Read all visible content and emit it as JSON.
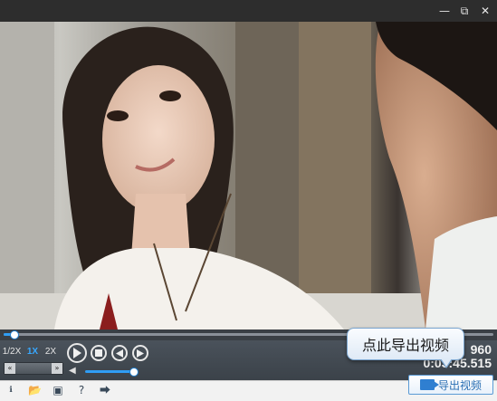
{
  "window": {
    "minimize_icon": "minimize-icon",
    "restore_icon": "restore-icon",
    "close_icon": "close-icon"
  },
  "player": {
    "progress_fraction": 0.02,
    "volume_fraction": 0.95,
    "speeds": [
      "1/2X",
      "1X",
      "2X"
    ],
    "active_speed": "1X",
    "time_top": "960",
    "time_bottom": "0:03:45.515"
  },
  "tooltip": {
    "text": "点此导出视频"
  },
  "export": {
    "label": "导出视频",
    "accent": "#2f7fd1"
  },
  "toolbar": {
    "icons": [
      "video-info-icon",
      "open-folder-icon",
      "save-icon",
      "help-icon",
      "share-icon"
    ]
  }
}
